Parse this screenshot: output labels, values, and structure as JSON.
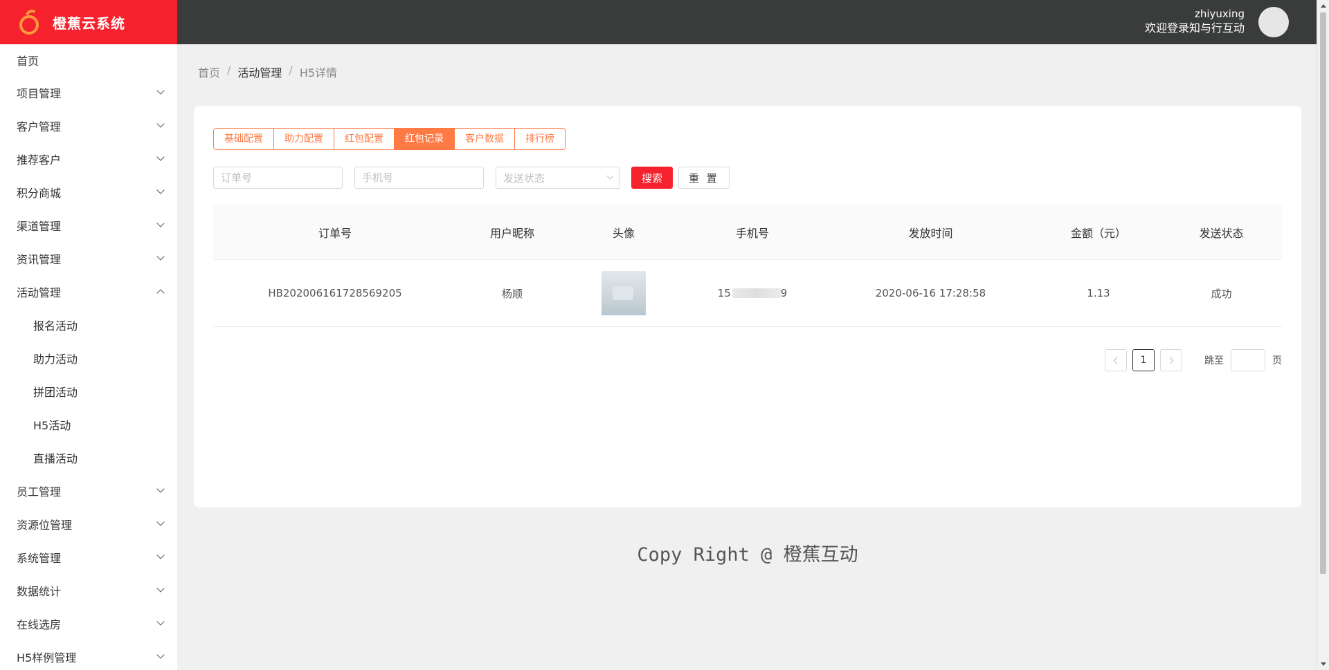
{
  "app": {
    "logo_text": "橙蕉云系统"
  },
  "header": {
    "username": "zhiyuxing",
    "welcome": "欢迎登录知与行互动"
  },
  "sidebar": {
    "items": [
      {
        "label": "首页"
      },
      {
        "label": "项目管理"
      },
      {
        "label": "客户管理"
      },
      {
        "label": "推荐客户"
      },
      {
        "label": "积分商城"
      },
      {
        "label": "渠道管理"
      },
      {
        "label": "资讯管理"
      },
      {
        "label": "活动管理",
        "expanded": true
      },
      {
        "label": "员工管理"
      },
      {
        "label": "资源位管理"
      },
      {
        "label": "系统管理"
      },
      {
        "label": "数据统计"
      },
      {
        "label": "在线选房"
      },
      {
        "label": "H5样例管理"
      }
    ],
    "activity_sub": [
      "报名活动",
      "助力活动",
      "拼团活动",
      "H5活动",
      "直播活动"
    ]
  },
  "breadcrumb": [
    "首页",
    "活动管理",
    "H5详情"
  ],
  "tabs": [
    "基础配置",
    "助力配置",
    "红包配置",
    "红包记录",
    "客户数据",
    "排行榜"
  ],
  "active_tab": "红包记录",
  "filters": {
    "order_placeholder": "订单号",
    "phone_placeholder": "手机号",
    "status_placeholder": "发送状态",
    "search_label": "搜索",
    "reset_label": "重 置"
  },
  "table": {
    "columns": [
      "订单号",
      "用户昵称",
      "头像",
      "手机号",
      "发放时间",
      "金额（元）",
      "发送状态"
    ],
    "rows": [
      {
        "order": "HB202006161728569205",
        "nickname": "杨顺",
        "phone_prefix": "15",
        "phone_suffix": "9",
        "time": "2020-06-16 17:28:58",
        "amount": "1.13",
        "status": "成功"
      }
    ]
  },
  "pagination": {
    "current": "1",
    "jump_label": "跳至",
    "page_label": "页"
  },
  "footer": "Copy Right @ 橙蕉互动",
  "colors": {
    "brand": "#f5222d",
    "tab_accent": "#ff7a45",
    "header_bg": "#3a3b3b"
  }
}
